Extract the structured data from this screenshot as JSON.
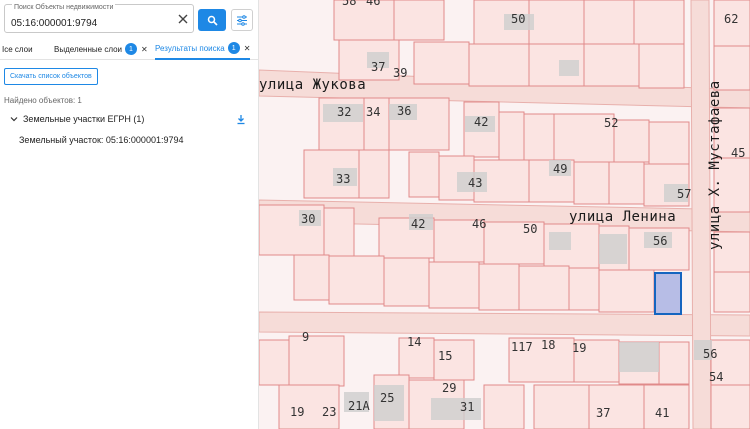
{
  "search": {
    "legend": "Поиск Объекты недвижимости",
    "value": "05:16:000001:9794"
  },
  "tabs": {
    "all": "Ісе слои",
    "selected": "Выделенные слои",
    "selected_count": "1",
    "results": "Результаты поиска",
    "results_count": "1"
  },
  "results": {
    "download_label": "Скачать список объектов",
    "found": "Найдено объектов: 1",
    "group_label": "Земельные участки ЕГРН (1)",
    "item_label": "Земельный участок: 05:16:000001:9794"
  },
  "map": {
    "streets": {
      "zhukova": "улица Жукова",
      "lenina": "улица Ленина",
      "mustafaeva": "улица Х. Мустафаева"
    },
    "house_numbers": [
      "58",
      "46",
      "50",
      "62",
      "37",
      "39",
      "32",
      "34",
      "36",
      "42",
      "52",
      "45",
      "49",
      "43",
      "33",
      "57",
      "30",
      "42",
      "46",
      "50",
      "56",
      "9",
      "14",
      "15",
      "117",
      "18",
      "19",
      "56",
      "29",
      "54",
      "19",
      "23",
      "21А",
      "25",
      "31",
      "37",
      "41"
    ]
  },
  "colors": {
    "accent": "#1e88e5",
    "parcel_stroke": "#e08a8a",
    "highlight_fill": "#b7bde6",
    "highlight_stroke": "#1565c0"
  },
  "icons": [
    "clear-icon",
    "search-icon",
    "filter-icon",
    "chevron-down-icon",
    "download-icon"
  ]
}
